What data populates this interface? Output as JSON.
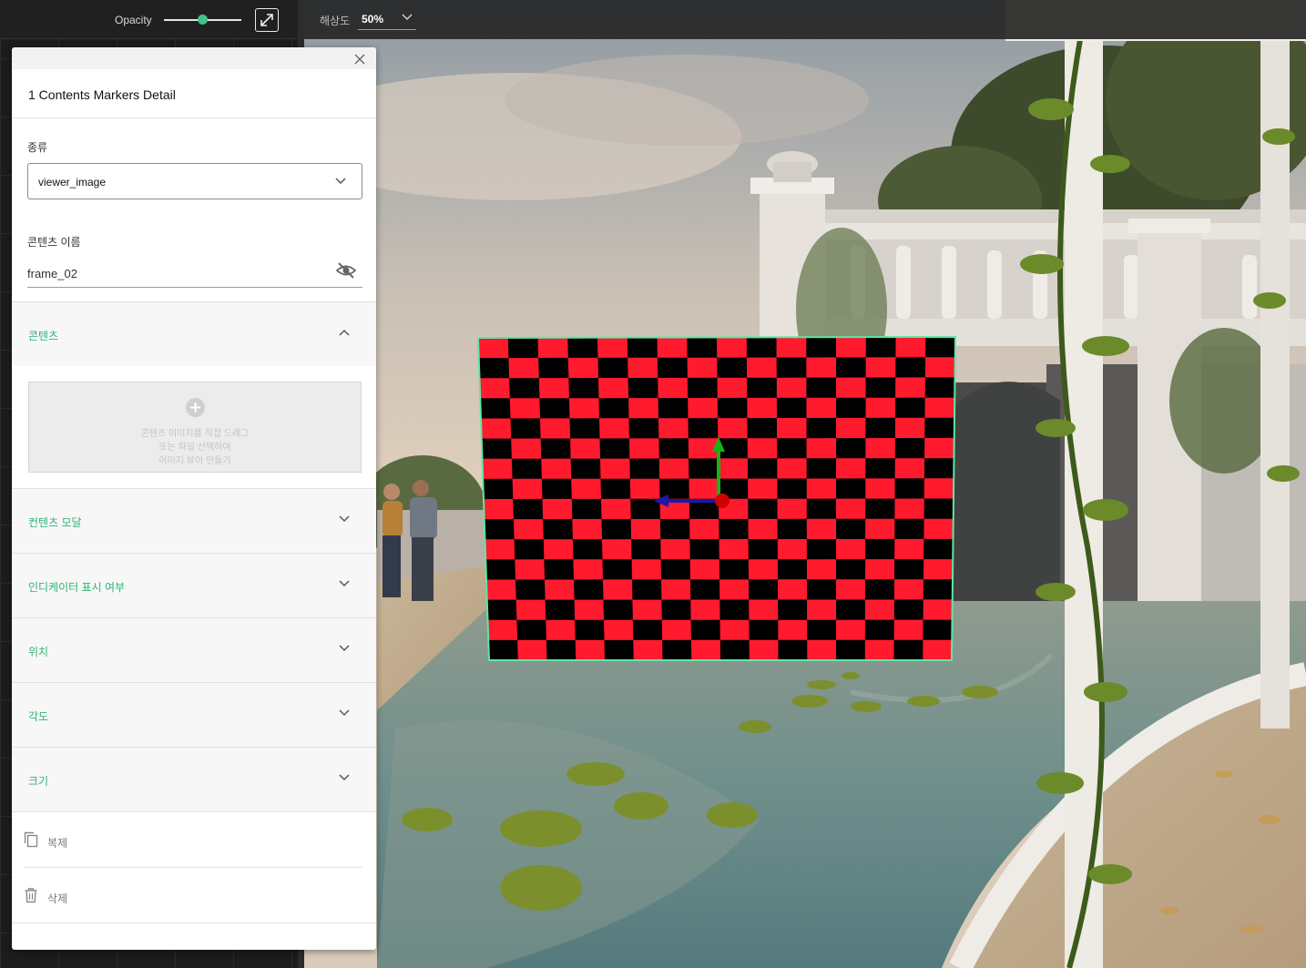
{
  "toolbar": {
    "opacity_label": "Opacity",
    "opacity_value": 0.5,
    "expand_icon": "expand-arrows-icon",
    "resolution_label": "해상도",
    "resolution_value": "50%"
  },
  "panel": {
    "title": "1 Contents Markers Detail",
    "type_label": "종류",
    "type_value": "viewer_image",
    "name_label": "콘텐츠 이름",
    "name_value": "frame_02",
    "sections": [
      {
        "label": "콘텐츠",
        "expanded": true
      },
      {
        "label": "컨텐츠 모달",
        "expanded": false
      },
      {
        "label": "인디케이터 표시 여부",
        "expanded": false
      },
      {
        "label": "위치",
        "expanded": false
      },
      {
        "label": "각도",
        "expanded": false
      },
      {
        "label": "크기",
        "expanded": false
      }
    ],
    "upload": {
      "line1": "콘텐츠 이미지를 직접 드래그",
      "line2": "또는 파일 선택하여",
      "line3": "이미지 뷰어 만들기"
    },
    "actions": {
      "duplicate": "복제",
      "delete": "삭제"
    }
  },
  "colors": {
    "accent": "#2fb378",
    "checker_red": "#ff1a2e",
    "checker_black": "#000000",
    "frame_outline": "#5ee6a6",
    "gizmo_x": "#1a1aa8",
    "gizmo_y": "#17b417",
    "gizmo_origin": "#d40000"
  }
}
